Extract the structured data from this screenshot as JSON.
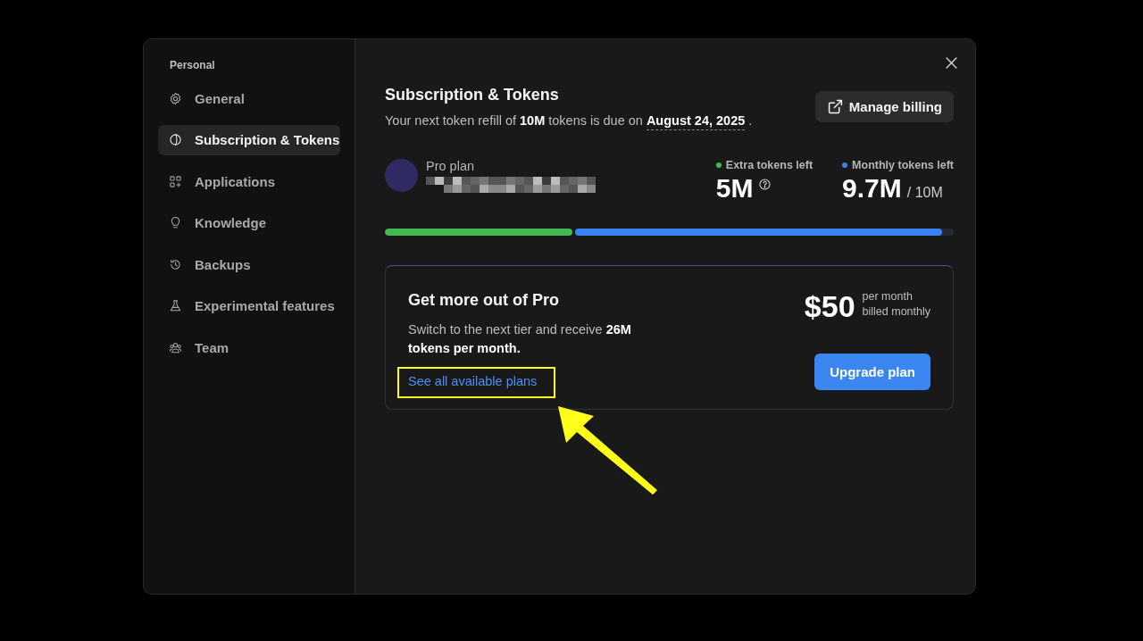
{
  "sidebar": {
    "section": "Personal",
    "items": [
      {
        "label": "General",
        "kind": "gear",
        "selected": false
      },
      {
        "label": "Subscription & Tokens",
        "kind": "coin",
        "selected": true
      },
      {
        "label": "Applications",
        "kind": "apps",
        "selected": false
      },
      {
        "label": "Knowledge",
        "kind": "bulb",
        "selected": false
      },
      {
        "label": "Backups",
        "kind": "history",
        "selected": false
      },
      {
        "label": "Experimental features",
        "kind": "flask",
        "selected": false
      },
      {
        "label": "Team",
        "kind": "team",
        "selected": false
      }
    ]
  },
  "header": {
    "title": "Subscription & Tokens",
    "refill_text": "Your next token refill of **10M** tokens is due on",
    "refill_date": "August 24, 2025",
    "refill_end": ".",
    "manage_button": "Manage billing"
  },
  "plan": {
    "name": "Pro plan",
    "account": {
      "kind": "redacted"
    }
  },
  "extra_tokens": {
    "label": "Extra tokens left",
    "value": "5M",
    "color": "#3fb950",
    "level": 0.33
  },
  "monthly_tokens": {
    "label": "Monthly tokens left",
    "value": "9.7M",
    "total": "/ 10M",
    "color": "#3b82f6",
    "level": 0.97
  },
  "upgrade_card": {
    "title": "Get more out of Pro",
    "text": "Switch to the next tier and receive **26M tokens per month.**",
    "link": "See all available plans",
    "price": "$50",
    "price_note_1": "per month",
    "price_note_2": "billed monthly",
    "button": "Upgrade plan"
  },
  "annotations": {
    "highlight": true,
    "arrow": true
  }
}
